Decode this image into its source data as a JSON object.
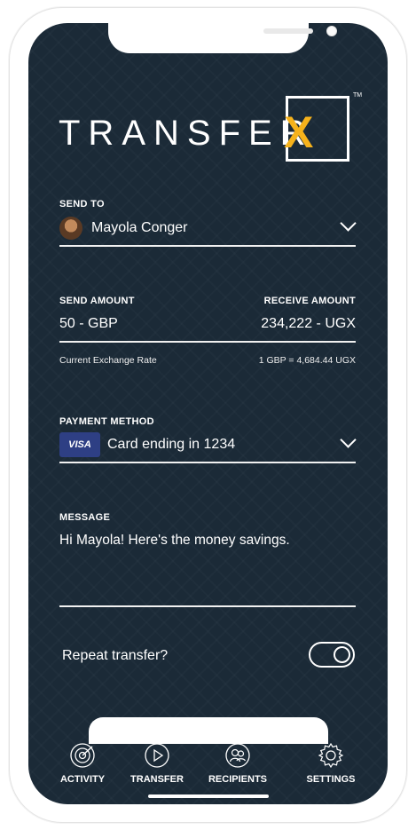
{
  "brand": {
    "logo_text": "TRANSFER",
    "logo_mark": "X",
    "trademark": "TM"
  },
  "colors": {
    "background": "#1b2a37",
    "accent": "#f6b21b",
    "visa_blue": "#2e3f84"
  },
  "send_to": {
    "label": "SEND TO",
    "recipient": "Mayola Conger"
  },
  "amounts": {
    "send_label": "SEND AMOUNT",
    "send_value": "50 - GBP",
    "receive_label": "RECEIVE AMOUNT",
    "receive_value": "234,222 - UGX",
    "rate_label": "Current Exchange Rate",
    "rate_value": "1 GBP = 4,684.44 UGX"
  },
  "payment": {
    "label": "PAYMENT METHOD",
    "card_brand": "VISA",
    "card_text": "Card ending in 1234"
  },
  "message": {
    "label": "MESSAGE",
    "text": "Hi Mayola! Here's the money savings."
  },
  "repeat": {
    "label": "Repeat transfer?",
    "enabled": true
  },
  "nav": [
    {
      "label": "ACTIVITY",
      "icon": "radar-icon"
    },
    {
      "label": "TRANSFER",
      "icon": "play-icon"
    },
    {
      "label": "RECIPIENTS",
      "icon": "people-icon"
    },
    {
      "label": "SETTINGS",
      "icon": "gear-icon"
    }
  ]
}
